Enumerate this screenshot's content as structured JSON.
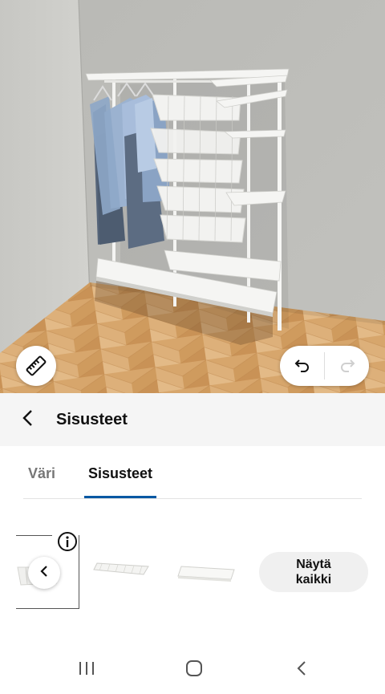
{
  "scene": {
    "measure_icon": "ruler-icon",
    "undo_icon": "undo-icon",
    "redo_icon": "redo-icon",
    "redo_enabled": false
  },
  "header": {
    "back_icon": "chevron-left-icon",
    "title": "Sisusteet"
  },
  "tabs": [
    {
      "label": "Väri",
      "active": false
    },
    {
      "label": "Sisusteet",
      "active": true
    }
  ],
  "accent_color": "#0058a3",
  "carousel": {
    "prev_icon": "chevron-left-icon",
    "info_icon": "info-icon",
    "products": [
      {
        "kind": "wire-basket"
      },
      {
        "kind": "mesh-shelf"
      },
      {
        "kind": "solid-shelf"
      }
    ],
    "show_all": {
      "line1": "Näytä",
      "line2": "kaikki"
    }
  },
  "system_nav": {
    "recents_icon": "recents-icon",
    "home_icon": "home-icon",
    "back_icon": "back-icon"
  }
}
